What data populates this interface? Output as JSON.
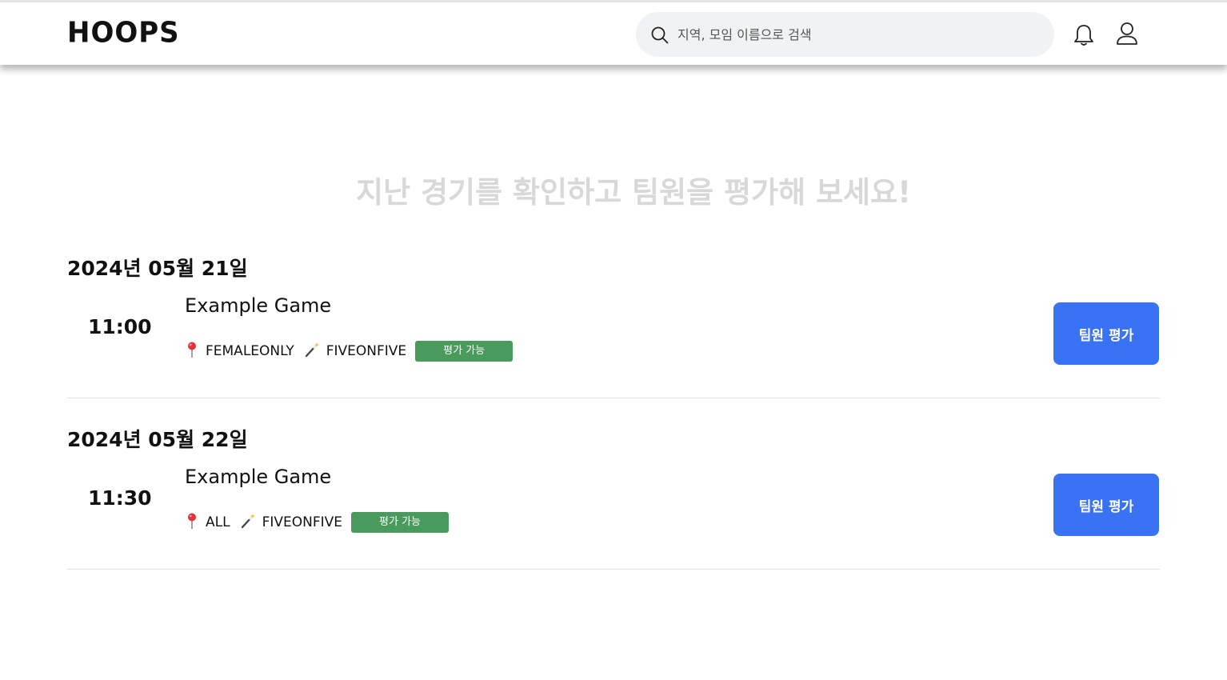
{
  "header": {
    "logo": "HOOPS",
    "search": {
      "placeholder": "지역, 모임 이름으로 검색",
      "value": ""
    },
    "icons": [
      "search-icon",
      "bell-icon",
      "user-icon"
    ]
  },
  "main": {
    "title": "지난 경기를 확인하고 팀원을 평가해 보세요!",
    "groups": [
      {
        "date": "2024년 05월 21일",
        "game": {
          "time": "11:00",
          "name": "Example Game",
          "gender": "FEMALEONLY",
          "format": "FIVEONFIVE",
          "status": "평가 가능",
          "button": "팀원 평가"
        }
      },
      {
        "date": "2024년 05월 22일",
        "game": {
          "time": "11:30",
          "name": "Example Game",
          "gender": "ALL",
          "format": "FIVEONFIVE",
          "status": "평가 가능",
          "button": "팀원 평가"
        }
      }
    ]
  },
  "colors": {
    "accent": "#3a72f4",
    "badge": "#4a9a5e",
    "title_muted": "#d8d8d8"
  }
}
